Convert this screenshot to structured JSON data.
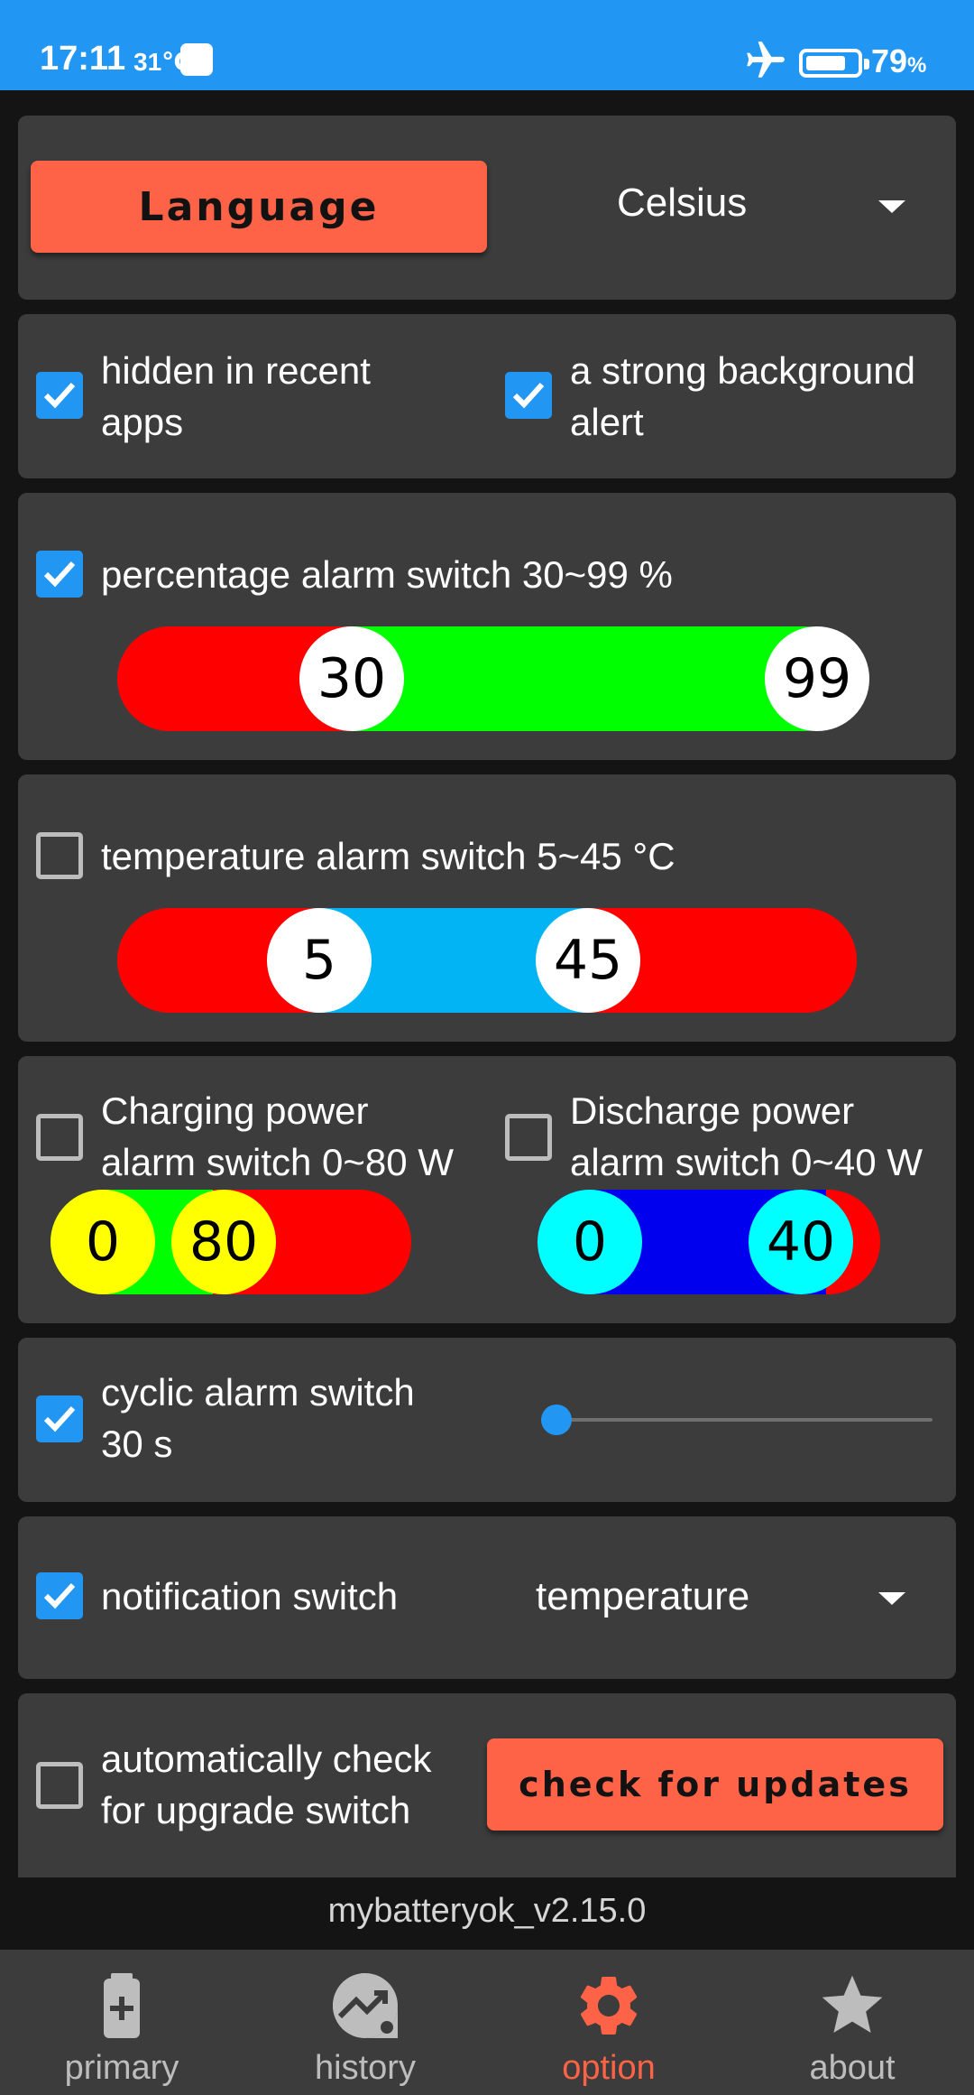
{
  "status_bar": {
    "time": "17:11",
    "temperature": "31℃",
    "battery_percent": "79",
    "battery_percent_sign": "%",
    "battery_level": 0.79
  },
  "settings": {
    "language_button": "Language",
    "unit_dropdown_value": "Celsius",
    "hidden_in_recent_apps": {
      "checked": true,
      "label_line1": "hidden in recent",
      "label_line2": "apps"
    },
    "strong_background_alert": {
      "checked": true,
      "label_line1": "a strong background",
      "label_line2": "alert"
    },
    "percentage_alarm": {
      "checked": true,
      "label": "percentage alarm switch 30~99 %",
      "range": [
        0,
        100
      ],
      "low": "30",
      "high": "99",
      "colors": {
        "below": "#ff0000",
        "between": "#00ff00",
        "above": "#03a9f4",
        "thumb": "#ffffff"
      }
    },
    "temperature_alarm": {
      "checked": false,
      "label": "temperature alarm switch 5~45 °C",
      "low": "5",
      "high": "45",
      "colors": {
        "below": "#ff0000",
        "between": "#03b4f4",
        "above": "#ff0000",
        "thumb": "#ffffff"
      }
    },
    "charging_power_alarm": {
      "checked": false,
      "label_line1": "Charging power",
      "label_line2": "alarm switch 0~80 W",
      "low": "0",
      "high": "80",
      "colors": {
        "between": "#00ff00",
        "above": "#ff0000",
        "thumb": "#ffff00"
      }
    },
    "discharge_power_alarm": {
      "checked": false,
      "label_line1": "Discharge power",
      "label_line2": "alarm switch 0~40 W",
      "low": "0",
      "high": "40",
      "colors": {
        "between": "#0000ee",
        "above": "#ff0000",
        "thumb": "#00ffff"
      }
    },
    "cyclic_alarm": {
      "checked": true,
      "label_line1": "cyclic alarm switch",
      "label_line2": "30 s",
      "slider_level": 0.0
    },
    "notification": {
      "checked": true,
      "label": "notification switch",
      "dropdown_value": "temperature"
    },
    "auto_upgrade_check": {
      "checked": false,
      "label_line1": "automatically check",
      "label_line2": "for upgrade switch"
    },
    "check_updates_button": "check for updates"
  },
  "version": "mybatteryok_v2.15.0",
  "nav": {
    "items": [
      {
        "label": "primary",
        "icon": "battery-plus-icon",
        "active": false
      },
      {
        "label": "history",
        "icon": "history-chart-icon",
        "active": false
      },
      {
        "label": "option",
        "icon": "gear-icon",
        "active": true
      },
      {
        "label": "about",
        "icon": "star-icon",
        "active": false
      }
    ]
  },
  "colors": {
    "accent": "#ff6347",
    "primary": "#2196f3",
    "card": "#3c3c3c",
    "background": "#141414"
  }
}
